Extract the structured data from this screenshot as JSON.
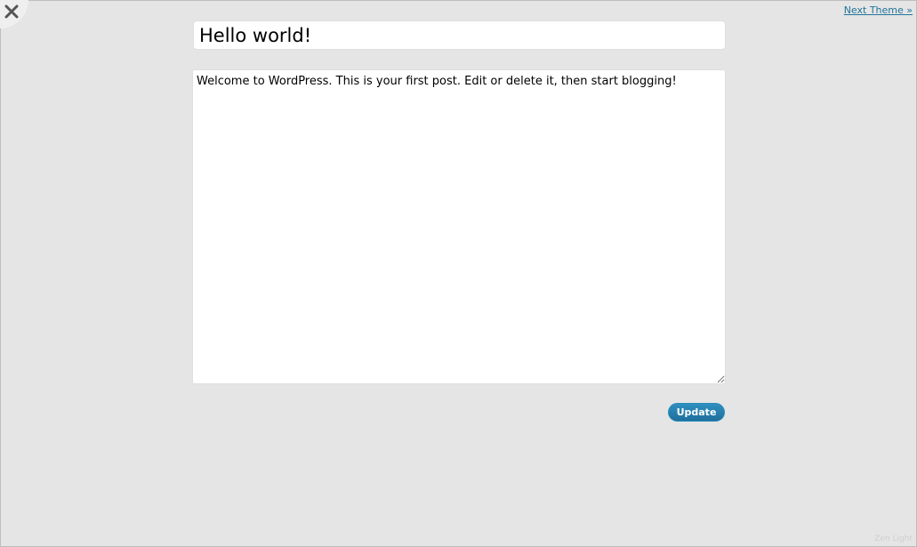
{
  "close": {
    "icon": "close-icon"
  },
  "nav": {
    "next_theme_label": "Next Theme »"
  },
  "post": {
    "title_value": "Hello world!",
    "content_value": "Welcome to WordPress. This is your first post. Edit or delete it, then start blogging!"
  },
  "actions": {
    "update_label": "Update"
  },
  "footer": {
    "theme_name": "Zen Light"
  },
  "colors": {
    "background": "#e5e5e5",
    "link": "#21759b",
    "button": "#21759b"
  }
}
